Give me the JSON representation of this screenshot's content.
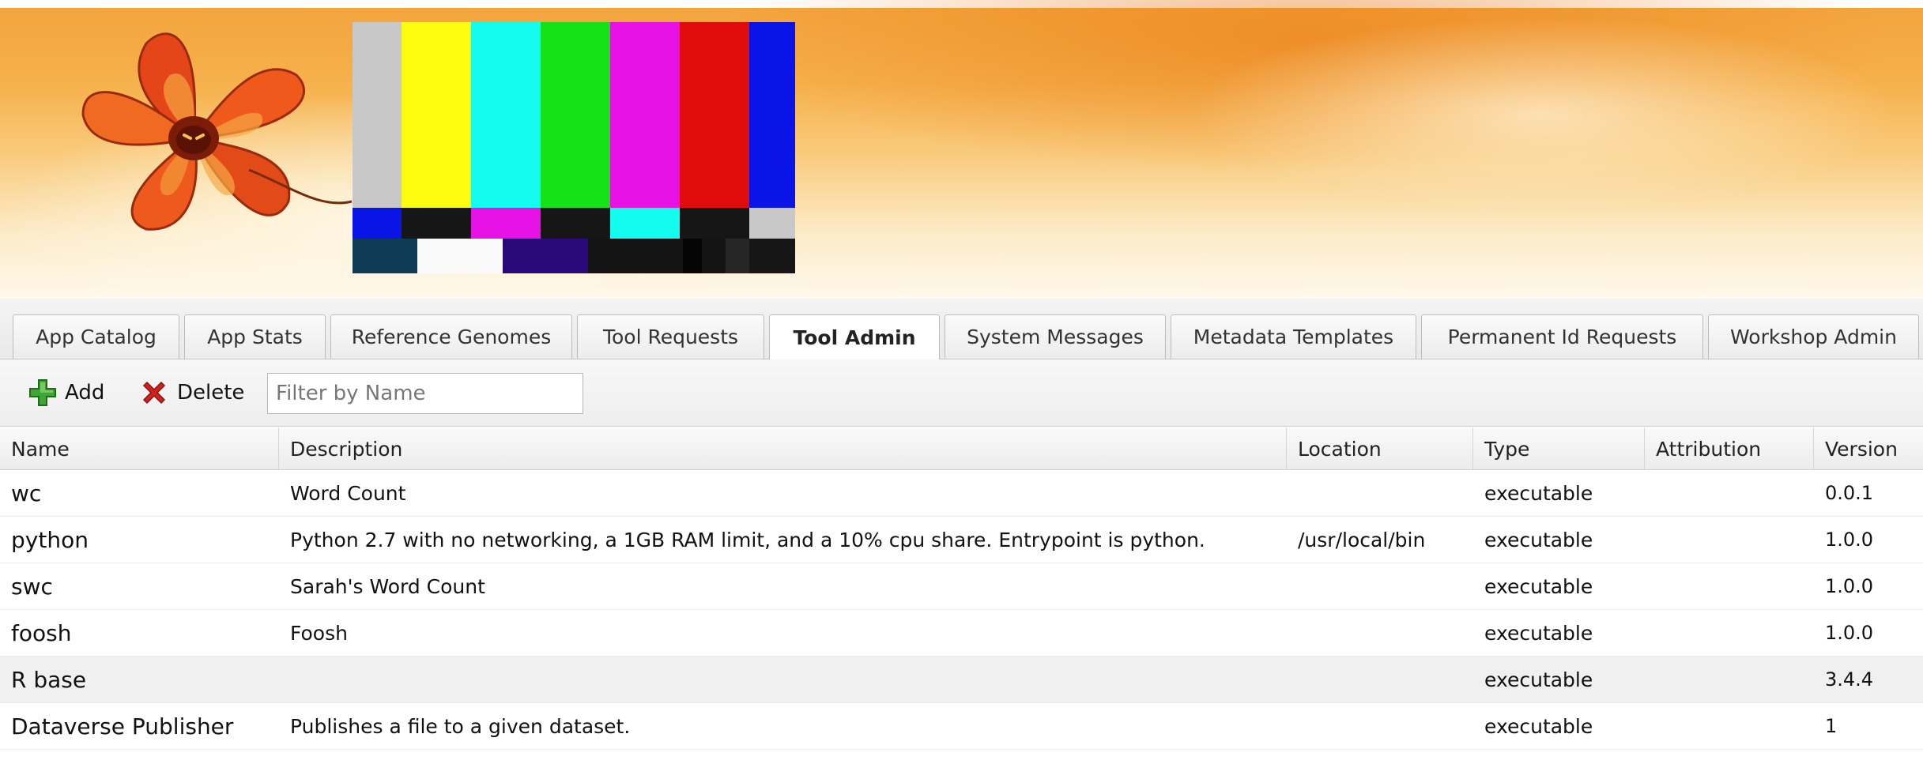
{
  "tabs": [
    {
      "label": "App Catalog",
      "active": false
    },
    {
      "label": "App Stats",
      "active": false
    },
    {
      "label": "Reference Genomes",
      "active": false
    },
    {
      "label": "Tool Requests",
      "active": false
    },
    {
      "label": "Tool Admin",
      "active": true
    },
    {
      "label": "System Messages",
      "active": false
    },
    {
      "label": "Metadata Templates",
      "active": false
    },
    {
      "label": "Permanent Id Requests",
      "active": false
    },
    {
      "label": "Workshop Admin",
      "active": false
    }
  ],
  "toolbar": {
    "add_label": "Add",
    "add_icon": "plus-icon",
    "delete_label": "Delete",
    "delete_icon": "x-icon",
    "filter_placeholder": "Filter by Name",
    "filter_value": ""
  },
  "grid": {
    "columns": [
      "Name",
      "Description",
      "Location",
      "Type",
      "Attribution",
      "Version"
    ],
    "rows": [
      {
        "name": "wc",
        "description": "Word Count",
        "location": "",
        "type": "executable",
        "attribution": "",
        "version": "0.0.1",
        "shaded": false
      },
      {
        "name": "python",
        "description": "Python 2.7 with no networking, a 1GB RAM limit, and a 10% cpu share. Entrypoint is python.",
        "location": "/usr/local/bin",
        "type": "executable",
        "attribution": "",
        "version": "1.0.0",
        "shaded": false
      },
      {
        "name": "swc",
        "description": "Sarah's Word Count",
        "location": "",
        "type": "executable",
        "attribution": "",
        "version": "1.0.0",
        "shaded": false
      },
      {
        "name": "foosh",
        "description": "Foosh",
        "location": "",
        "type": "executable",
        "attribution": "",
        "version": "1.0.0",
        "shaded": false
      },
      {
        "name": "R base",
        "description": "",
        "location": "",
        "type": "executable",
        "attribution": "",
        "version": "3.4.4",
        "shaded": true
      },
      {
        "name": "Dataverse Publisher",
        "description": "Publishes a file to a given dataset.",
        "location": "",
        "type": "executable",
        "attribution": "",
        "version": "1",
        "shaded": false
      }
    ]
  },
  "colors": {
    "banner_orange": "#f3a33b",
    "add_green": "#3fa535",
    "delete_red": "#d0211b"
  }
}
